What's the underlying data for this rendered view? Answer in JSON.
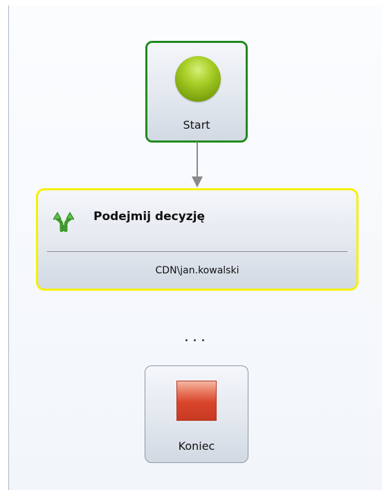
{
  "start": {
    "label": "Start",
    "icon": "green-circle-icon",
    "border_color": "#1f8a1f"
  },
  "decision": {
    "title": "Podejmij decyzję",
    "user": "CDN\\jan.kowalski",
    "icon": "decision-split-arrows-icon",
    "border_color": "#f7f000"
  },
  "ellipsis": "...",
  "end": {
    "label": "Koniec",
    "icon": "red-square-icon"
  }
}
